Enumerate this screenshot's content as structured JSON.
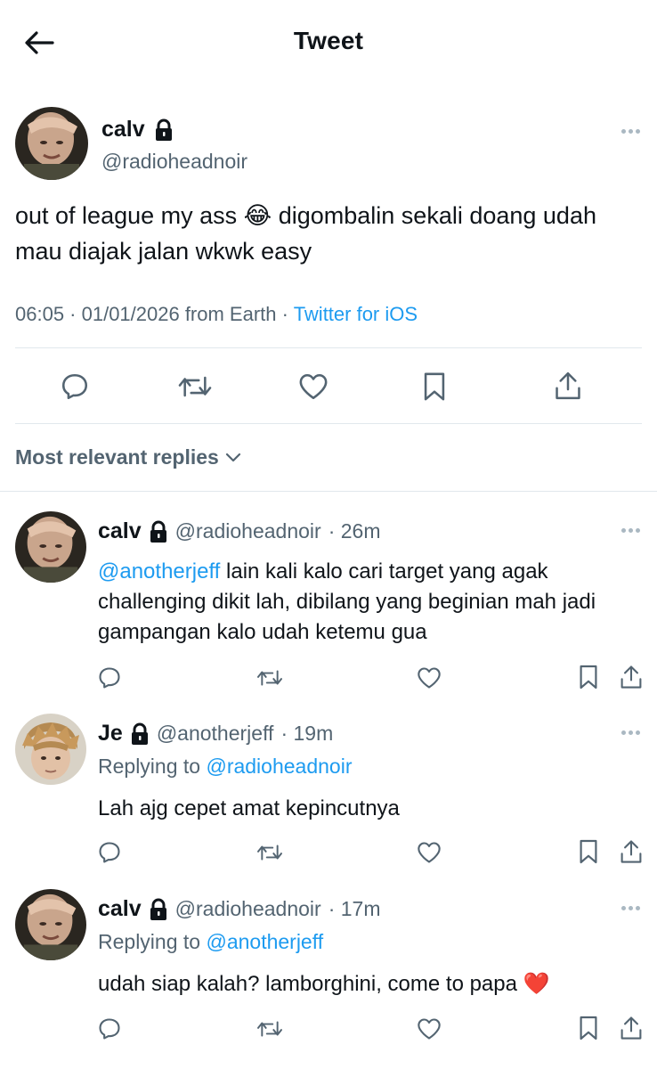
{
  "header": {
    "title": "Tweet"
  },
  "tweet": {
    "name": "calv",
    "handle": "@radioheadnoir",
    "text_part1": "out of league my ass ",
    "emoji": "😂",
    "text_part2": " digombalin sekali doang udah mau diajak jalan wkwk easy",
    "time_date": "06:05 · 01/01/2026 from Earth · ",
    "source": "Twitter for iOS"
  },
  "sort": {
    "label": "Most relevant replies"
  },
  "replies": [
    {
      "name": "calv",
      "handle": "@radioheadnoir",
      "time": "· 26m",
      "mention": "@anotherjeff",
      "text": " lain kali kalo cari target yang agak challenging dikit lah, dibilang yang beginian mah jadi gampangan kalo udah ketemu gua"
    },
    {
      "name": "Je",
      "handle": "@anotherjeff",
      "time": "· 19m",
      "replying_label": "Replying to ",
      "replying_to": "@radioheadnoir",
      "text": "Lah ajg cepet amat kepincutnya"
    },
    {
      "name": "calv",
      "handle": "@radioheadnoir",
      "time": "· 17m",
      "replying_label": "Replying to ",
      "replying_to": "@anotherjeff",
      "text": "udah siap kalah? lamborghini, come to papa ",
      "emoji": "❤️"
    }
  ],
  "icons": {
    "back": "arrow-left-icon",
    "lock": "lock-icon",
    "more": "more-icon",
    "reply": "reply-icon",
    "retweet": "retweet-icon",
    "like": "heart-icon",
    "bookmark": "bookmark-icon",
    "share": "share-icon",
    "chevron": "chevron-down-icon"
  },
  "colors": {
    "link": "#1d9bf0",
    "secondary": "#536471",
    "divider": "#e1e8ed"
  }
}
